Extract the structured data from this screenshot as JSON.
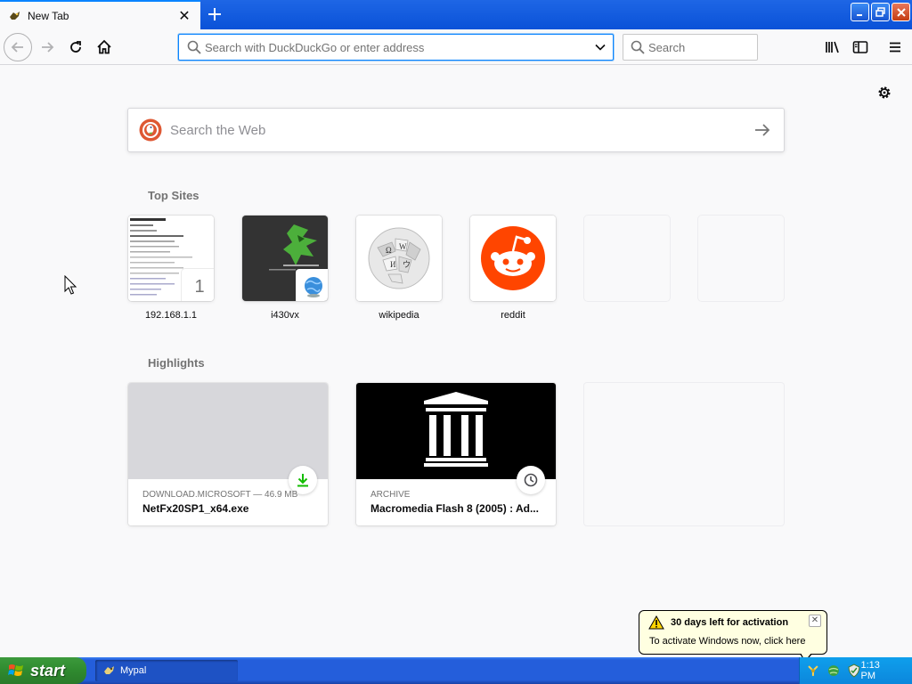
{
  "browser": {
    "tab": {
      "title": "New Tab",
      "favicon": "mypal-icon"
    },
    "window_controls": [
      "minimize",
      "restore",
      "close"
    ]
  },
  "toolbar": {
    "urlbar_placeholder": "Search with DuckDuckGo or enter address",
    "search_placeholder": "Search"
  },
  "newtab": {
    "web_search_placeholder": "Search the Web",
    "top_sites_title": "Top Sites",
    "top_sites": [
      {
        "label": "192.168.1.1",
        "badge": "1"
      },
      {
        "label": "i430vx"
      },
      {
        "label": "wikipedia"
      },
      {
        "label": "reddit"
      },
      {
        "label": ""
      },
      {
        "label": ""
      }
    ],
    "highlights_title": "Highlights",
    "highlights": [
      {
        "context": "DOWNLOAD.MICROSOFT — 46.9 MB",
        "title": "NetFx20SP1_x64.exe",
        "icon": "download-icon"
      },
      {
        "context": "ARCHIVE",
        "title": "Macromedia Flash 8 (2005) : Ad...",
        "icon": "clock-icon"
      }
    ]
  },
  "balloon": {
    "title": "30 days left for activation",
    "text": "To activate Windows now, click here"
  },
  "taskbar": {
    "start_label": "start",
    "task_label": "Mypal",
    "clock": "1:13 PM"
  },
  "colors": {
    "accent": "#0a84ff",
    "reddit": "#ff4500",
    "download_green": "#12bc00",
    "xp_blue": "#245edb"
  }
}
